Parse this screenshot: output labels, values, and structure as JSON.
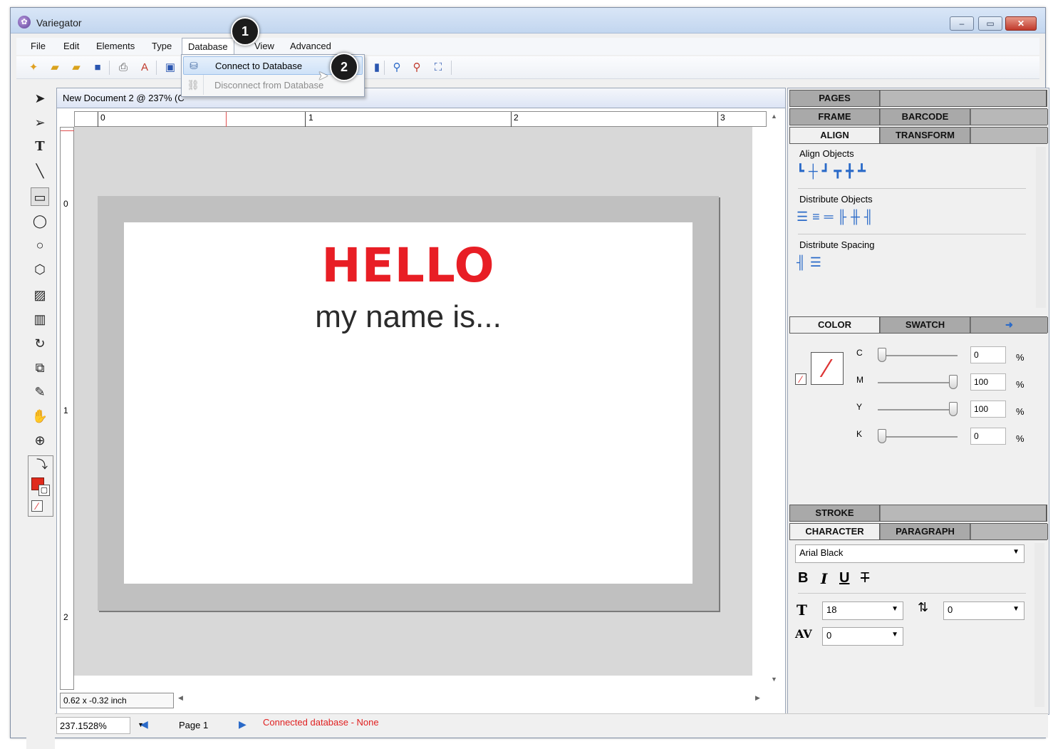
{
  "window": {
    "title": "Variegator",
    "icon": "app-logo-icon",
    "controls": [
      "minimize",
      "maximize",
      "close"
    ]
  },
  "menu": {
    "file": "File",
    "edit": "Edit",
    "elements": "Elements",
    "type": "Type",
    "database": "Database",
    "view": "View",
    "advanced": "Advanced"
  },
  "dropdown": {
    "connect": "Connect to Database",
    "disconnect": "Disconnect from Database"
  },
  "callouts": {
    "one": "1",
    "two": "2"
  },
  "document": {
    "tab_title": "New Document 2 @ 237% (C",
    "ruler_h": [
      "0",
      "1",
      "2",
      "3"
    ],
    "ruler_v": [
      "0",
      "1",
      "2"
    ],
    "hello": "HELLO",
    "subtitle": "my name is...",
    "coords": "0.62 x -0.32 inch"
  },
  "panels": {
    "pages_tab": "PAGES",
    "frame_tab": "FRAME",
    "barcode_tab": "BARCODE",
    "align_tab": "ALIGN",
    "transform_tab": "TRANSFORM",
    "align_objects": "Align Objects",
    "distribute_objects": "Distribute Objects",
    "distribute_spacing": "Distribute Spacing",
    "color_tab": "COLOR",
    "swatch_tab": "SWATCH",
    "stroke_tab": "STROKE",
    "character_tab": "CHARACTER",
    "paragraph_tab": "PARAGRAPH"
  },
  "color": {
    "c_label": "C",
    "m_label": "M",
    "y_label": "Y",
    "k_label": "K",
    "c": "0",
    "m": "100",
    "y": "100",
    "k": "0",
    "c_level": 0,
    "m_level": 1,
    "y_level": 1,
    "k_level": 0,
    "unit": "%"
  },
  "character": {
    "font": "Arial Black",
    "bold": "B",
    "italic": "I",
    "underline": "U",
    "strike": "T",
    "size": "18",
    "baseline": "0",
    "tracking": "0"
  },
  "status": {
    "zoom": "237.1528%",
    "page": "Page 1",
    "db": "Connected database - None"
  },
  "colors": {
    "accent": "#e81e25",
    "fill_swatch": "#e02a1c"
  }
}
